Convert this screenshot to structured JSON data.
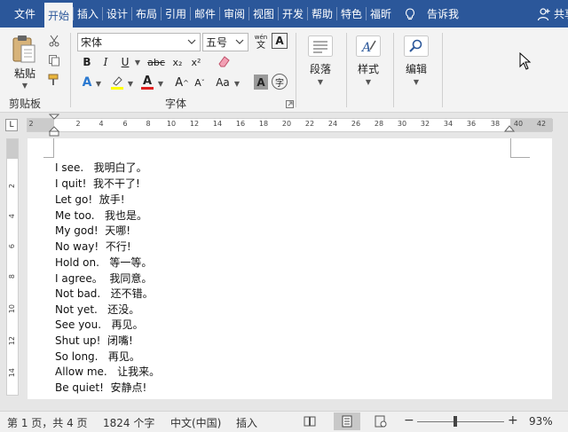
{
  "tabs": [
    {
      "label": "文件",
      "active": false
    },
    {
      "label": "开始",
      "active": true
    },
    {
      "label": "插入",
      "active": false
    },
    {
      "label": "设计",
      "active": false
    },
    {
      "label": "布局",
      "active": false
    },
    {
      "label": "引用",
      "active": false
    },
    {
      "label": "邮件",
      "active": false
    },
    {
      "label": "审阅",
      "active": false
    },
    {
      "label": "视图",
      "active": false
    },
    {
      "label": "开发",
      "active": false
    },
    {
      "label": "帮助",
      "active": false
    },
    {
      "label": "特色",
      "active": false
    },
    {
      "label": "福昕",
      "active": false
    }
  ],
  "tell_me": "告诉我",
  "share": "共享",
  "clipboard": {
    "paste_label": "粘贴",
    "group_label": "剪贴板"
  },
  "font": {
    "name": "宋体",
    "size": "五号",
    "group_label": "字体",
    "phonetic_top": "wén",
    "phonetic_bottom": "文",
    "border_char": "A",
    "bold": "B",
    "italic": "I",
    "underline": "U",
    "strike": "abc",
    "sub": "x₂",
    "sup": "x²",
    "effects": "A",
    "font_color": "A",
    "grow": "A",
    "shrink": "A",
    "aa": "Aa",
    "shade_char": "A",
    "enclose_char": "字"
  },
  "paragraph": {
    "label": "段落"
  },
  "styles": {
    "label": "样式"
  },
  "editing": {
    "label": "编辑"
  },
  "ruler": {
    "tab_selector": "L",
    "ticks": [
      "2",
      "2",
      "4",
      "6",
      "8",
      "10",
      "12",
      "14",
      "16",
      "18",
      "20",
      "22",
      "24",
      "26",
      "28",
      "30",
      "32",
      "34",
      "36",
      "38",
      "40",
      "42"
    ],
    "vticks": [
      "2",
      "4",
      "6",
      "8",
      "10",
      "12",
      "14"
    ]
  },
  "document_lines": [
    "I see.   我明白了。",
    "I quit!  我不干了!",
    "Let go!  放手!",
    "Me too.   我也是。",
    "My god!  天哪!",
    "No way!  不行!",
    "Hold on.   等一等。",
    "I agree。  我同意。",
    "Not bad.   还不错。",
    "Not yet.   还没。",
    "See you.   再见。",
    "Shut up!  闭嘴!",
    "So long.   再见。",
    "Allow me.   让我来。",
    "Be quiet!  安静点!"
  ],
  "status": {
    "page": "第 1 页，共 4 页",
    "words": "1824 个字",
    "language": "中文(中国)",
    "mode": "插入",
    "zoom_out": "−",
    "zoom_in": "+",
    "zoom": "93%"
  },
  "colors": {
    "brand": "#2b579a",
    "highlight": "#ffff00",
    "font_color": "#e02020"
  }
}
